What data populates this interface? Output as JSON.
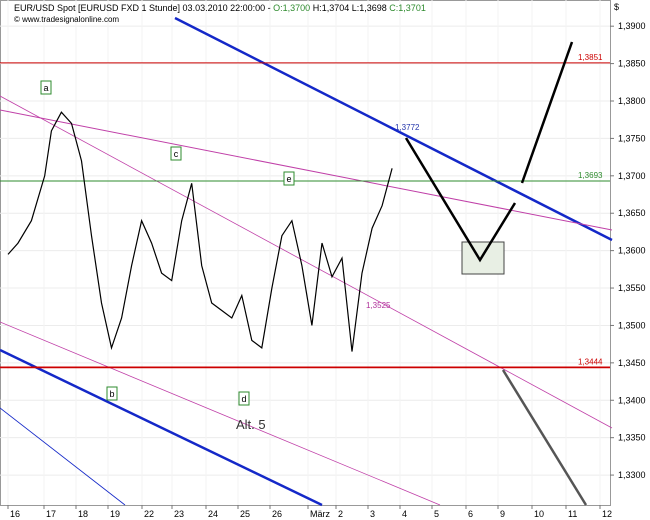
{
  "header": {
    "instrument": "EUR/USD Spot [EURUSD FXD  1 Stunde] 03.03.2010 22:00:00 - ",
    "open": "O:1,3700",
    "high": "H:1,3704",
    "low": "L:1,3698",
    "close": "C:1,3701",
    "source": "© www.tradesignalonline.com",
    "currency_symbol": "$"
  },
  "chart_data": {
    "type": "line",
    "title": "EUR/USD Spot [EURUSD FXD  1 Stunde] 03.03.2010 22:00:00",
    "ylim": [
      1.326,
      1.3935
    ],
    "yticks": [
      "1,3900",
      "1,3850",
      "1,3800",
      "1,3750",
      "1,3700",
      "1,3650",
      "1,3600",
      "1,3550",
      "1,3500",
      "1,3450",
      "1,3400",
      "1,3350",
      "1,3300"
    ],
    "xticks": [
      "16",
      "17",
      "18",
      "19",
      "22",
      "23",
      "24",
      "25",
      "26",
      "März",
      "2",
      "3",
      "4",
      "5",
      "6",
      "9",
      "10",
      "11",
      "12"
    ],
    "price_series_x": [
      0,
      0.3,
      0.7,
      1.1,
      1.3,
      1.6,
      1.9,
      2.2,
      2.5,
      2.8,
      3.1,
      3.4,
      3.7,
      4.0,
      4.3,
      4.6,
      4.9,
      5.2,
      5.5,
      5.8,
      6.1,
      6.4,
      6.7,
      7.0,
      7.3,
      7.6,
      7.9,
      8.2,
      8.5,
      8.8,
      9.1,
      9.4,
      9.7,
      10.0,
      10.3,
      10.6,
      10.9,
      11.2,
      11.5
    ],
    "price_series_y": [
      1.3595,
      1.361,
      1.364,
      1.37,
      1.376,
      1.3785,
      1.377,
      1.372,
      1.362,
      1.353,
      1.347,
      1.351,
      1.358,
      1.364,
      1.361,
      1.357,
      1.356,
      1.364,
      1.369,
      1.358,
      1.353,
      1.352,
      1.351,
      1.354,
      1.348,
      1.347,
      1.355,
      1.362,
      1.364,
      1.358,
      1.35,
      1.361,
      1.3565,
      1.359,
      1.3465,
      1.357,
      1.363,
      1.366,
      1.371
    ],
    "horizontal_levels": [
      {
        "label": "1,3851",
        "value": 1.3851,
        "color": "#cc0000"
      },
      {
        "label": "1,3693",
        "value": 1.3693,
        "color": "#2e8b2e"
      },
      {
        "label": "1,3444",
        "value": 1.3444,
        "color": "#cc0000"
      }
    ],
    "point_labels": [
      {
        "label": "1,3772",
        "color": "#2233aa"
      },
      {
        "label": "1,3525",
        "color": "#b0309a"
      }
    ],
    "wave_labels": [
      "a",
      "b",
      "c",
      "d",
      "e"
    ],
    "annotation": "Alt. 5",
    "grid": true,
    "colors": {
      "price": "#000000",
      "trend_blue": "#1428c8",
      "trend_magenta": "#c040a8",
      "resistance": "#cc0000",
      "support_green": "#2e8b2e",
      "forecast": "#000000",
      "forecast_grey": "#555555",
      "box_fill": "#e8efe4"
    }
  }
}
